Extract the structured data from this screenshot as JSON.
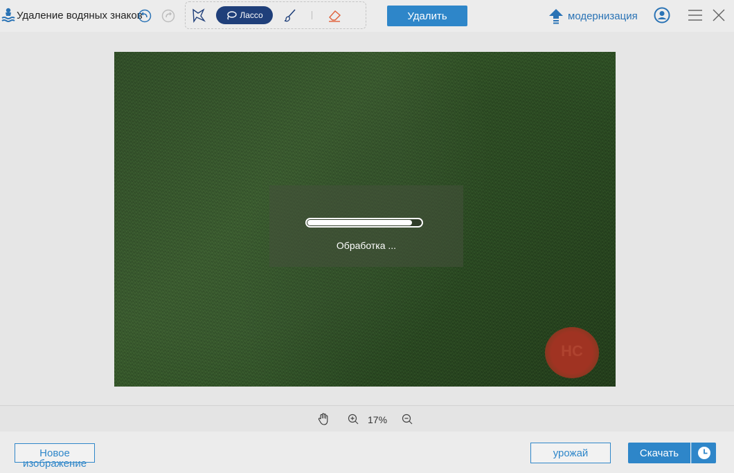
{
  "app": {
    "title": "Удаление водяных знаков"
  },
  "toolbar": {
    "lasso_label": "Лассо",
    "remove_label": "Удалить",
    "upgrade_label": "модернизация"
  },
  "canvas": {
    "watermark_text": "HC",
    "processing": {
      "text": "Обработка ...",
      "progress_percent": 92
    }
  },
  "zoom": {
    "level": "17%"
  },
  "footer": {
    "new_image_label": "Новое изображение",
    "harvest_label": "урожай",
    "download_label": "Скачать"
  },
  "colors": {
    "accent": "#2e86c9",
    "lasso_active": "#1f3f7a",
    "upgrade": "#2a73b5",
    "eraser": "#e0603a"
  },
  "icons": {
    "logo": "swimmer-wave-icon",
    "undo": "undo-icon",
    "redo": "redo-icon",
    "polygon": "polygon-select-icon",
    "lasso": "lasso-icon",
    "brush": "brush-icon",
    "eraser": "eraser-icon",
    "upgrade": "upgrade-arrow-icon",
    "account": "account-icon",
    "menu": "hamburger-menu-icon",
    "close": "close-icon",
    "hand": "hand-icon",
    "zoom_in": "zoom-in-icon",
    "zoom_out": "zoom-out-icon",
    "schedule": "clock-icon"
  }
}
